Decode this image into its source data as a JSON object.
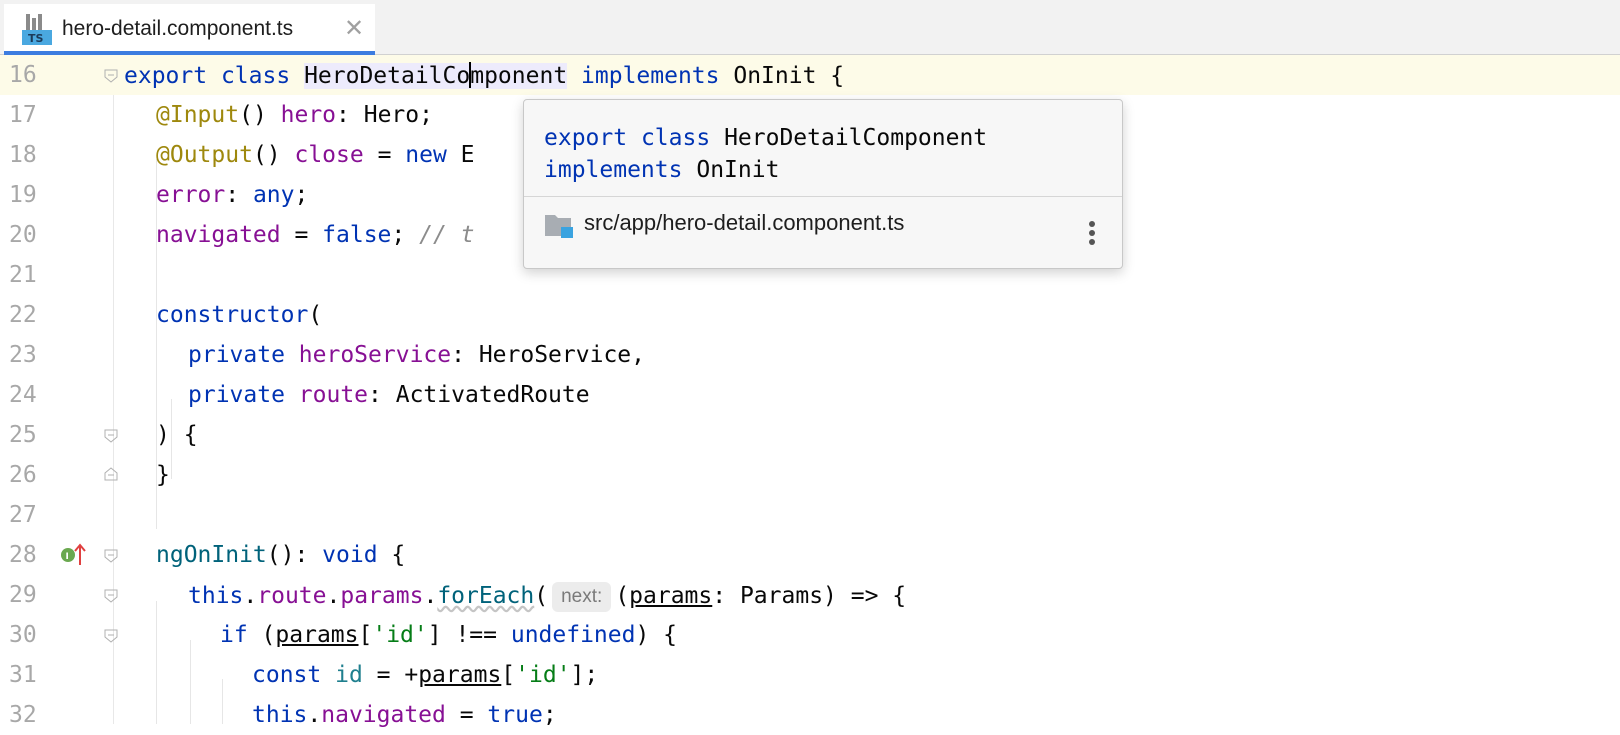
{
  "tab": {
    "icon_label": "TS",
    "title": "hero-detail.component.ts",
    "close_glyph": "✕"
  },
  "popup": {
    "sig_line1_kw1": "export",
    "sig_line1_kw2": "class",
    "sig_line1_name": "HeroDetailComponent",
    "sig_line2_kw": "implements",
    "sig_line2_name": "OnInit",
    "path": "src/app/hero-detail.component.ts"
  },
  "hint": "next:",
  "lines": {
    "l16": {
      "num": "16"
    },
    "l17": {
      "num": "17"
    },
    "l18": {
      "num": "18"
    },
    "l19": {
      "num": "19"
    },
    "l20": {
      "num": "20",
      "comment": "// t"
    },
    "l21": {
      "num": "21"
    },
    "l22": {
      "num": "22"
    },
    "l23": {
      "num": "23"
    },
    "l24": {
      "num": "24"
    },
    "l25": {
      "num": "25"
    },
    "l26": {
      "num": "26"
    },
    "l27": {
      "num": "27"
    },
    "l28": {
      "num": "28"
    },
    "l29": {
      "num": "29"
    },
    "l30": {
      "num": "30"
    },
    "l31": {
      "num": "31"
    },
    "l32": {
      "num": "32"
    }
  },
  "colors": {
    "keyword": "#0033b3",
    "decorator": "#9e880d",
    "field": "#871094",
    "string": "#067d17",
    "tab_accent": "#3c7ce0"
  }
}
